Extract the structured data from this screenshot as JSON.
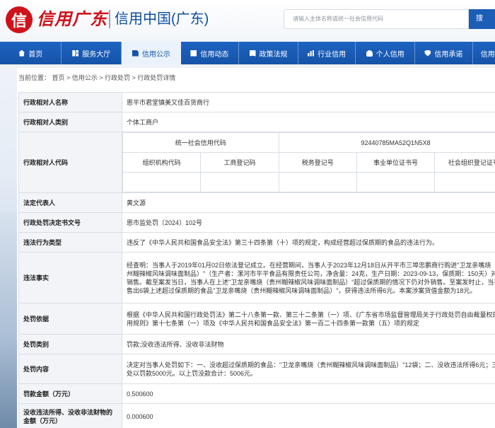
{
  "header": {
    "logo_script": "信用广东",
    "logo_badge": "信",
    "logo_text": "信用中国(广东)",
    "search": {
      "placeholder": "请输入主体名称或统一社会信用代码",
      "button": "搜"
    }
  },
  "nav": {
    "items": [
      {
        "label": "首页",
        "icon": "home-icon"
      },
      {
        "label": "服务大厅",
        "icon": "grid-icon"
      },
      {
        "label": "信用公示",
        "icon": "document-icon",
        "active": true
      },
      {
        "label": "信用动态",
        "icon": "news-icon"
      },
      {
        "label": "政策法规",
        "icon": "book-icon"
      },
      {
        "label": "行业信用",
        "icon": "chart-icon"
      },
      {
        "label": "个人信用",
        "icon": "user-icon"
      },
      {
        "label": "信用承诺",
        "icon": "shield-icon"
      },
      {
        "label": "信用导",
        "icon": "more-icon"
      }
    ]
  },
  "breadcrumb": "当前位置：  首页 > 信用公示 > 行政处罚 > 行政处罚详情",
  "record": {
    "name_label": "行政相对人名称",
    "name": "恩平市君堂镇美又佳百货商行",
    "type_label": "行政相对人类别",
    "type": "个体工商户",
    "code_label": "行政相对人代码",
    "code_headers": {
      "uscc": "统一社会信用代码",
      "org": "组织机构代码",
      "biz_reg": "工商登记码",
      "tax_reg": "税务登记号",
      "public_inst": "事业单位证书号",
      "social_org": "社会组织登记证号"
    },
    "uscc": "92440785MA52Q1N5X8",
    "legal_rep_label": "法定代表人",
    "legal_rep": "黄文源",
    "decision_no_label": "行政处罚决定书文号",
    "decision_no": "恩市监处罚〔2024〕102号",
    "violation_type_label": "违法行为类型",
    "violation_type": "违反了《中华人民共和国食品安全法》第三十四条第（十）项的规定，构成经营超过保质期的食品的违法行为。",
    "facts_label": "违法事实",
    "facts": "经查明：当事人于2019年01月02日依法登记成立。在经营期间，当事人于2023年12月18日从开平市三埠忠鹏商行购进\"卫龙亲嘴烧（贵州糊辣椒风味调味面制品）\"（生产者：漯河市平平食品有限责任公司，净含量：24克，生产日期：2023-09-13，保质期：150天）对外销售。截至案发当日，当事人在上述\"卫龙亲嘴烧（贵州糊辣椒风味调味面制品）\"超过保质期的情况下仍对外销售。至案发时止，当事人售出6袋上述超过保质期的食品\"卫龙亲嘴烧（贵州糊辣椒风味调味面制品）\"，获得违法所得6元。本案涉案货值金额为18元。",
    "basis_label": "处罚依据",
    "basis": "根据《中华人民共和国行政处罚法》第二十八条第一款、第三十二条第（一）项、《广东省市场监督管理局关于行政处罚自由裁量权的适用规则》第十七条第（一）项及《中华人民共和国食品安全法》第一百二十四条第一款第（五）项的规定",
    "penalty_type_label": "处罚类别",
    "penalty_type": "罚款;没收违法所得、没收非法财物",
    "content_label": "处罚内容",
    "content": "决定对当事人处罚如下：一、没收超过保质期的食品：\"卫龙亲嘴烧（贵州糊辣椒风味调味面制品）\"12袋；二、没收违法所得6元；三、处以罚款5000元。以上罚没款合计：5006元。",
    "fine_label": "罚款金额（万元）",
    "fine": "0.500600",
    "confiscation_label": "没收违法所得、没收非法财物的金额（万元）",
    "confiscation": "0.000600"
  }
}
